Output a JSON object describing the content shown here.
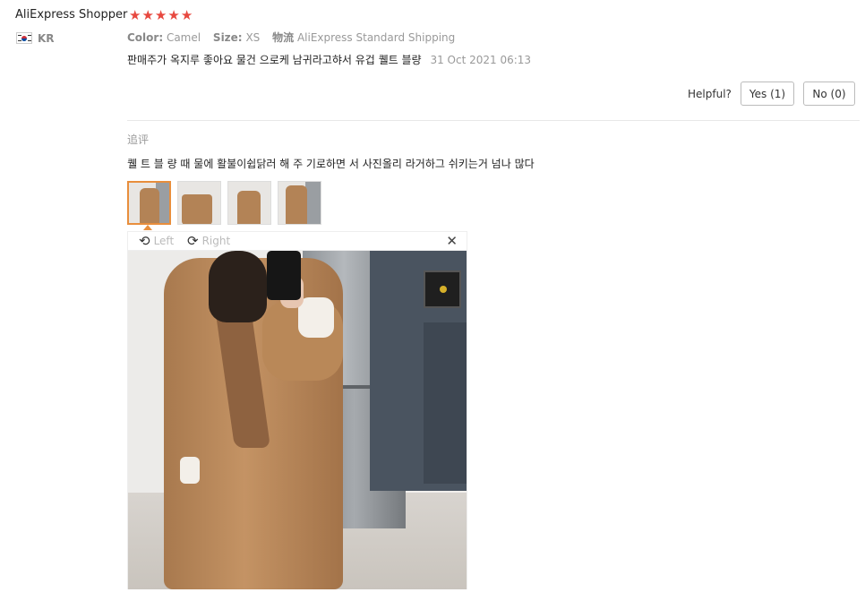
{
  "reviewer": {
    "name": "AliExpress Shopper",
    "rating": 5,
    "country": "KR"
  },
  "meta": {
    "color_label": "Color:",
    "color_value": "Camel",
    "size_label": "Size:",
    "size_value": "XS",
    "shipping_label": "物流",
    "shipping_value": "AliExpress Standard Shipping"
  },
  "review": {
    "text": "판매주가 옥지루 좋아요 물건 으로케 남귀라고햐서 유겁 퀠트 블량",
    "date": "31 Oct 2021 06:13"
  },
  "helpful": {
    "label": "Helpful?",
    "yes_label": "Yes (1)",
    "no_label": "No (0)"
  },
  "additional": {
    "label": "追评",
    "text": "퀠 트 블 량 때 물에 활불이쉽닭러 해 주 기로하면 서 사진올리 라거하그 쉬키는거 넘나 많다"
  },
  "thumbnails": [
    {
      "name": "photo-1",
      "active": true
    },
    {
      "name": "photo-2",
      "active": false
    },
    {
      "name": "photo-3",
      "active": false
    },
    {
      "name": "photo-4",
      "active": false
    }
  ],
  "viewer": {
    "rotate_left_label": "Left",
    "rotate_right_label": "Right",
    "close_icon": "close-icon"
  },
  "colors": {
    "star": "#e7483f",
    "thumb_active_border": "#e88e3c",
    "muted_text": "#999999"
  }
}
